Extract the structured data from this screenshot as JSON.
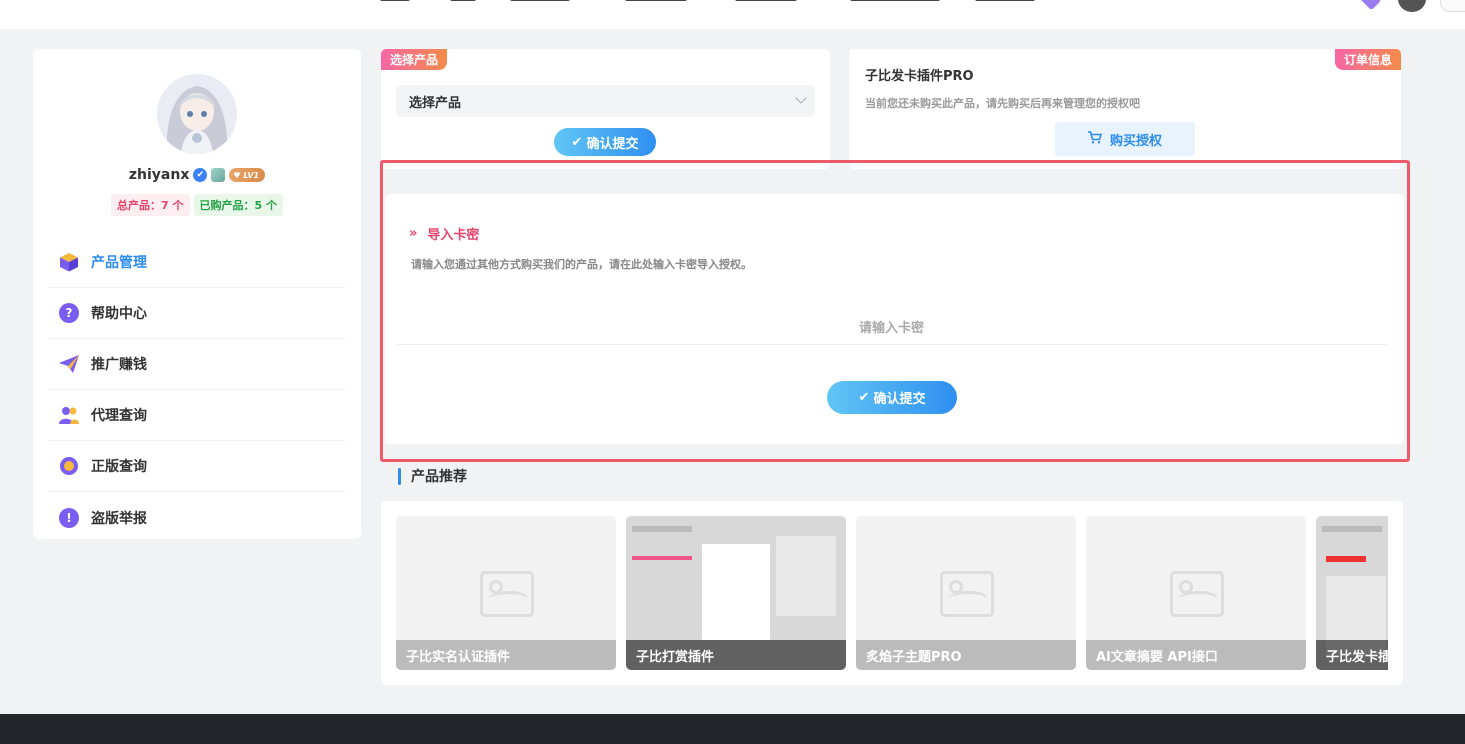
{
  "user": {
    "name": "zhiyanx",
    "level_badge": "LV1",
    "total_products": "总产品：7 个",
    "bought_products": "已购产品：5 个"
  },
  "menu": [
    {
      "label": "产品管理",
      "icon": "cube-icon",
      "active": true
    },
    {
      "label": "帮助中心",
      "icon": "question-icon"
    },
    {
      "label": "推广赚钱",
      "icon": "paper-plane-icon"
    },
    {
      "label": "代理查询",
      "icon": "users-icon"
    },
    {
      "label": "正版查询",
      "icon": "magnifier-icon"
    },
    {
      "label": "盗版举报",
      "icon": "exclamation-icon"
    }
  ],
  "select_card": {
    "tag": "选择产品",
    "select_value": "选择产品",
    "submit_label": "确认提交"
  },
  "order_card": {
    "tag": "订单信息",
    "title": "子比发卡插件PRO",
    "desc": "当前您还未购买此产品，请先购买后再来管理您的授权吧",
    "buy_label": "购买授权"
  },
  "import_card": {
    "title": "导入卡密",
    "desc": "请输入您通过其他方式购买我们的产品，请在此处输入卡密导入授权。",
    "input_placeholder": "请输入卡密",
    "submit_label": "确认提交"
  },
  "recommend": {
    "title": "产品推荐",
    "items": [
      {
        "caption": "子比实名认证插件"
      },
      {
        "caption": "子比打赏插件"
      },
      {
        "caption": "炙焰子主题PRO"
      },
      {
        "caption": "AI文章摘要 API接口"
      },
      {
        "caption": "子比发卡插件PRO"
      }
    ]
  },
  "colors": {
    "accent_blue": "#2d8cf0",
    "highlight_red": "#ee5a6a",
    "tag_gradient_start": "#f766a5",
    "tag_gradient_end": "#f58b49"
  }
}
